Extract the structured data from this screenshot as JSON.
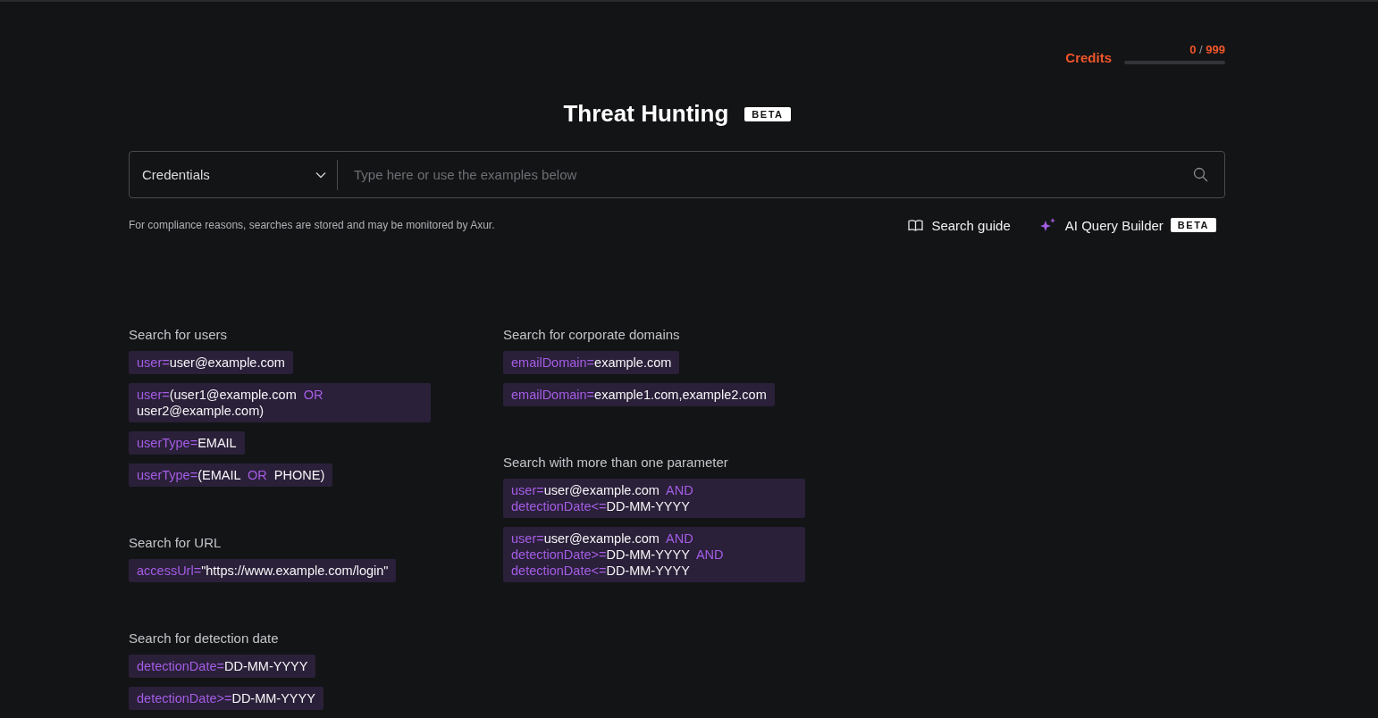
{
  "credits": {
    "label": "Credits",
    "used": "0",
    "separator": "/",
    "total": "999",
    "level": 0
  },
  "title": "Threat Hunting",
  "title_badge": "BETA",
  "search": {
    "category": "Credentials",
    "placeholder": "Type here or use the examples below"
  },
  "notice": "For compliance reasons, searches are stored and may be monitored by Axur.",
  "links": [
    {
      "kind": "guide",
      "label": "Search guide"
    },
    {
      "kind": "ai",
      "label": "AI Query Builder",
      "badge": "BETA"
    }
  ],
  "columns": [
    {
      "sections": [
        {
          "title": "Search for users",
          "examples": [
            [
              {
                "kind": "key",
                "text": "user="
              },
              {
                "kind": "value",
                "text": "user@example.com"
              }
            ],
            [
              {
                "kind": "key",
                "text": "user="
              },
              {
                "kind": "value",
                "text": "(user1@example.com"
              },
              {
                "kind": "op",
                "text": "OR"
              },
              {
                "kind": "value",
                "text": "user2@example.com)"
              }
            ],
            [
              {
                "kind": "key",
                "text": "userType="
              },
              {
                "kind": "value",
                "text": "EMAIL"
              }
            ],
            [
              {
                "kind": "key",
                "text": "userType="
              },
              {
                "kind": "value",
                "text": "(EMAIL"
              },
              {
                "kind": "op",
                "text": "OR"
              },
              {
                "kind": "value",
                "text": "PHONE)"
              }
            ]
          ]
        },
        {
          "title": "Search for URL",
          "examples": [
            [
              {
                "kind": "key",
                "text": "accessUrl="
              },
              {
                "kind": "value",
                "text": "\"https://www.example.com/login\""
              }
            ]
          ]
        },
        {
          "title": "Search for detection date",
          "examples": [
            [
              {
                "kind": "key",
                "text": "detectionDate="
              },
              {
                "kind": "value",
                "text": "DD-MM-YYYY"
              }
            ],
            [
              {
                "kind": "key",
                "text": "detectionDate>="
              },
              {
                "kind": "value",
                "text": "DD-MM-YYYY"
              }
            ]
          ]
        }
      ]
    },
    {
      "sections": [
        {
          "title": "Search for corporate domains",
          "examples": [
            [
              {
                "kind": "key",
                "text": "emailDomain="
              },
              {
                "kind": "value",
                "text": "example.com"
              }
            ],
            [
              {
                "kind": "key",
                "text": "emailDomain="
              },
              {
                "kind": "value",
                "text": "example1.com,example2.com"
              }
            ]
          ]
        },
        {
          "title": "Search with more than one parameter",
          "examples": [
            [
              {
                "kind": "key",
                "text": "user="
              },
              {
                "kind": "value",
                "text": "user@example.com"
              },
              {
                "kind": "op",
                "text": "AND"
              },
              {
                "kind": "key",
                "text": "detectionDate<="
              },
              {
                "kind": "value",
                "text": "DD-MM-YYYY"
              }
            ],
            [
              {
                "kind": "key",
                "text": "user="
              },
              {
                "kind": "value",
                "text": "user@example.com"
              },
              {
                "kind": "op",
                "text": "AND"
              },
              {
                "kind": "key",
                "text": "detectionDate>="
              },
              {
                "kind": "value",
                "text": "DD-MM-YYYY"
              },
              {
                "kind": "op",
                "text": "AND"
              },
              {
                "kind": "key",
                "text": "detectionDate<="
              },
              {
                "kind": "value",
                "text": "DD-MM-YYYY"
              }
            ]
          ]
        }
      ]
    }
  ]
}
